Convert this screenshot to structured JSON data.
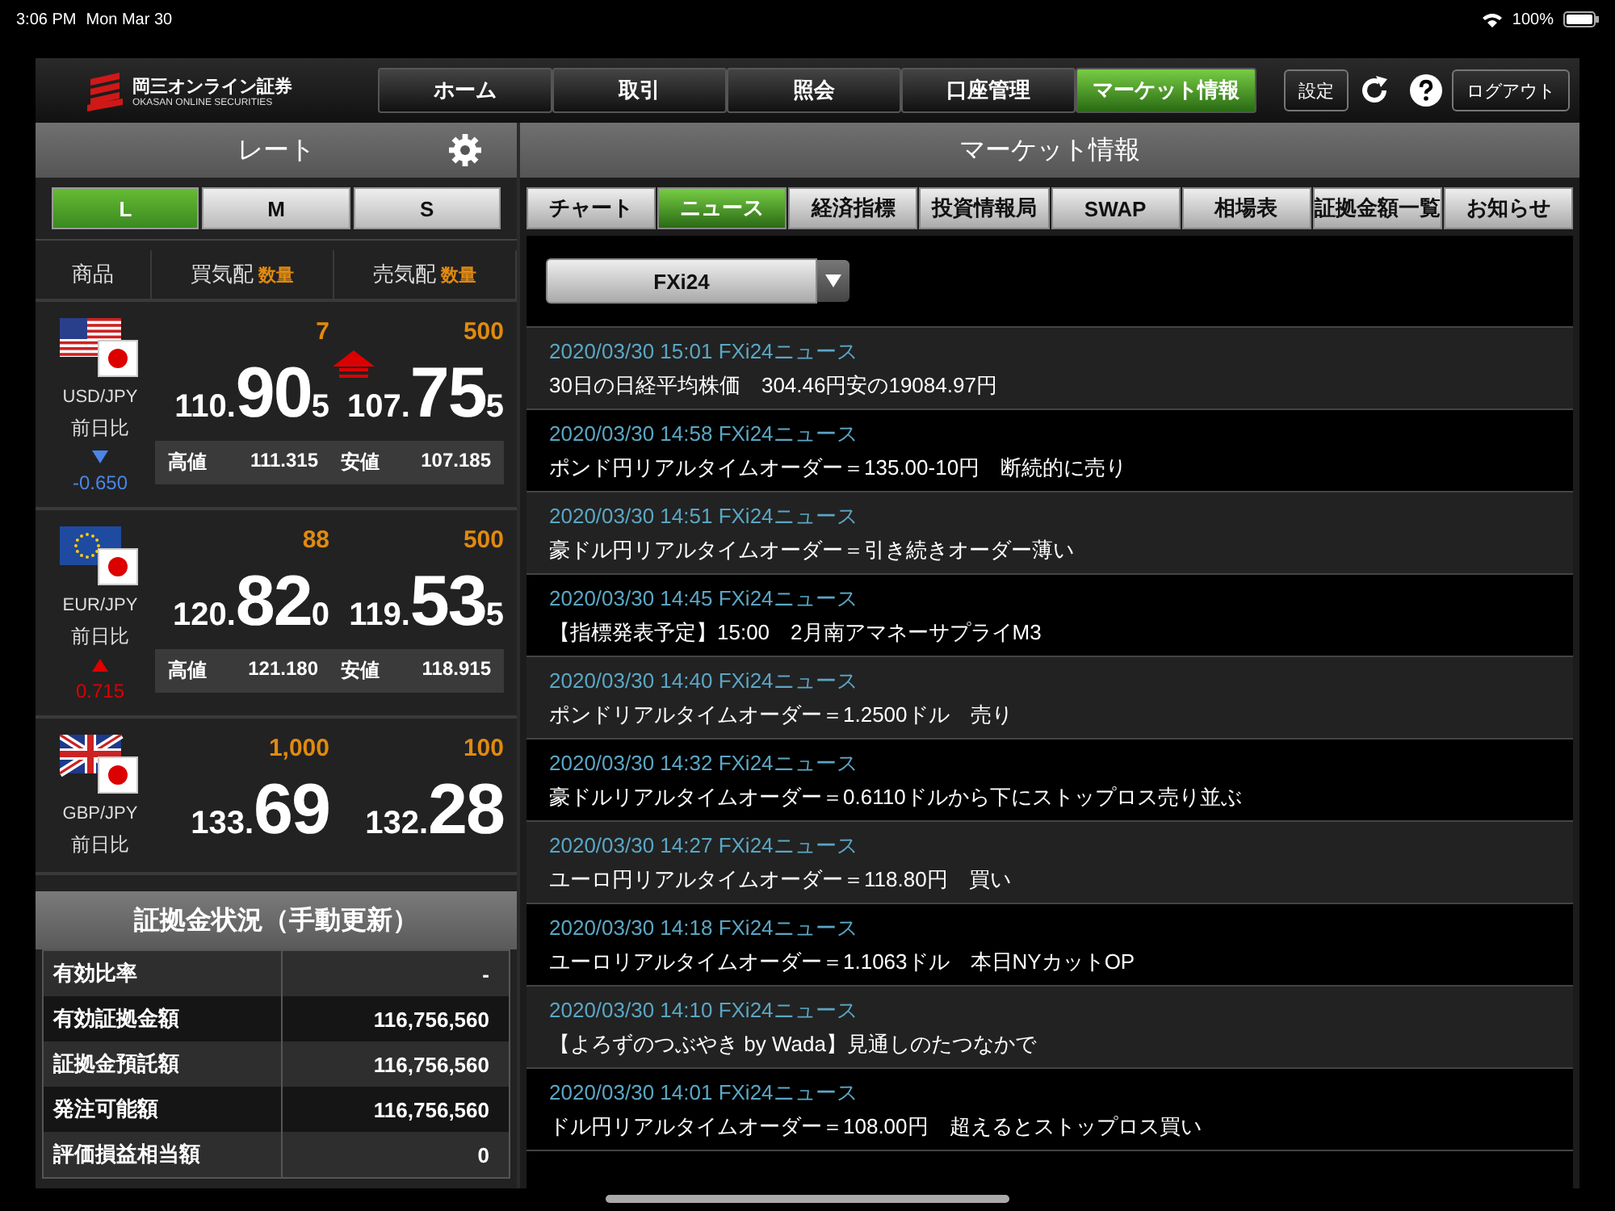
{
  "status_bar": {
    "time": "3:06 PM",
    "date": "Mon Mar 30",
    "battery": "100%"
  },
  "logo": {
    "name": "岡三オンライン証券",
    "subtitle": "OKASAN ONLINE SECURITIES"
  },
  "nav": [
    {
      "label": "ホーム",
      "selected": false
    },
    {
      "label": "取引",
      "selected": false
    },
    {
      "label": "照会",
      "selected": false
    },
    {
      "label": "口座管理",
      "selected": false
    },
    {
      "label": "マーケット情報",
      "selected": true
    }
  ],
  "settings_button": "設定",
  "logout_button": "ログアウト",
  "rate_panel": {
    "title": "レート",
    "sizes": [
      {
        "label": "L",
        "selected": true
      },
      {
        "label": "M",
        "selected": false
      },
      {
        "label": "S",
        "selected": false
      }
    ],
    "columns": [
      {
        "label": "商品"
      },
      {
        "label": "買気配",
        "qty": "数量"
      },
      {
        "label": "売気配",
        "qty": "数量"
      }
    ],
    "pairs": [
      {
        "kind": "us",
        "code": "USD/JPY",
        "change_label": "前日比",
        "rising": false,
        "change": "-0.650",
        "bid_qty": "7",
        "ask_qty": "500",
        "trend_up": true,
        "bid": [
          "110.",
          "90",
          "5"
        ],
        "ask": [
          "107.",
          "75",
          "5"
        ],
        "high_label": "高値",
        "high": "111.315",
        "low_label": "安値",
        "low": "107.185"
      },
      {
        "kind": "eu",
        "code": "EUR/JPY",
        "change_label": "前日比",
        "rising": true,
        "change": "0.715",
        "bid_qty": "88",
        "ask_qty": "500",
        "trend_up": false,
        "bid": [
          "120.",
          "82",
          "0"
        ],
        "ask": [
          "119.",
          "53",
          "5"
        ],
        "high_label": "高値",
        "high": "121.180",
        "low_label": "安値",
        "low": "118.915"
      },
      {
        "kind": "gb",
        "code": "GBP/JPY",
        "change_label": "前日比",
        "bid_qty": "1,000",
        "ask_qty": "100",
        "trend_up": false,
        "bid": [
          "133.",
          "69"
        ],
        "ask": [
          "132.",
          "28"
        ]
      }
    ]
  },
  "margin": {
    "title": "証拠金状況（手動更新）",
    "rows": [
      {
        "label": "有効比率",
        "value": "-"
      },
      {
        "label": "有効証拠金額",
        "value": "116,756,560"
      },
      {
        "label": "証拠金預託額",
        "value": "116,756,560"
      },
      {
        "label": "発注可能額",
        "value": "116,756,560"
      },
      {
        "label": "評価損益相当額",
        "value": "0"
      }
    ]
  },
  "market": {
    "title": "マーケット情報",
    "tabs": [
      {
        "label": "チャート",
        "selected": false
      },
      {
        "label": "ニュース",
        "selected": true
      },
      {
        "label": "経済指標",
        "selected": false
      },
      {
        "label": "投資情報局",
        "selected": false
      },
      {
        "label": "SWAP",
        "selected": false
      },
      {
        "label": "相場表",
        "selected": false
      },
      {
        "label": "証拠金額一覧",
        "selected": false
      },
      {
        "label": "お知らせ",
        "selected": false
      }
    ],
    "source": "FXi24",
    "news": [
      {
        "meta": "2020/03/30 15:01 FXi24ニュース",
        "headline": "30日の日経平均株価　304.46円安の19084.97円"
      },
      {
        "meta": "2020/03/30 14:58 FXi24ニュース",
        "headline": "ポンド円リアルタイムオーダー＝135.00-10円　断続的に売り"
      },
      {
        "meta": "2020/03/30 14:51 FXi24ニュース",
        "headline": "豪ドル円リアルタイムオーダー＝引き続きオーダー薄い"
      },
      {
        "meta": "2020/03/30 14:45 FXi24ニュース",
        "headline": "【指標発表予定】15:00　2月南アマネーサプライM3"
      },
      {
        "meta": "2020/03/30 14:40 FXi24ニュース",
        "headline": "ポンドリアルタイムオーダー＝1.2500ドル　売り"
      },
      {
        "meta": "2020/03/30 14:32 FXi24ニュース",
        "headline": "豪ドルリアルタイムオーダー＝0.6110ドルから下にストップロス売り並ぶ"
      },
      {
        "meta": "2020/03/30 14:27 FXi24ニュース",
        "headline": "ユーロ円リアルタイムオーダー＝118.80円　買い"
      },
      {
        "meta": "2020/03/30 14:18 FXi24ニュース",
        "headline": "ユーロリアルタイムオーダー＝1.1063ドル　本日NYカットOP"
      },
      {
        "meta": "2020/03/30 14:10 FXi24ニュース",
        "headline": "【よろずのつぶやき by Wada】見通しのたつなかで"
      },
      {
        "meta": "2020/03/30 14:01 FXi24ニュース",
        "headline": "ドル円リアルタイムオーダー＝108.00円　超えるとストップロス買い"
      }
    ]
  }
}
